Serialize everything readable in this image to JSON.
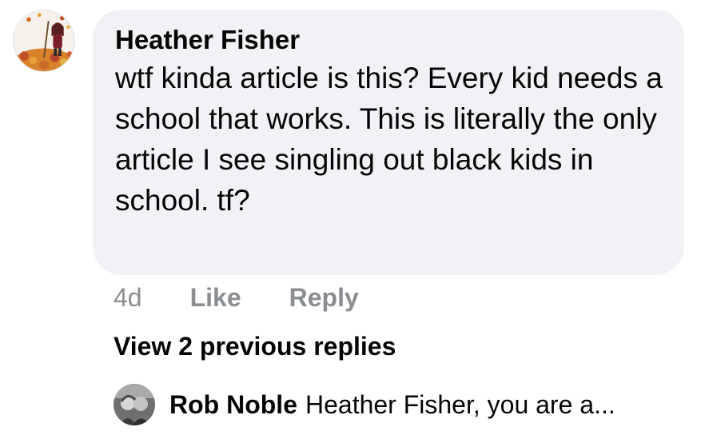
{
  "comment": {
    "author": "Heather Fisher",
    "text": "wtf kinda article is this? Every kid needs a school that works. This is literally the only article I see singling out black kids in school. tf?",
    "timestamp": "4d",
    "like_label": "Like",
    "reply_label": "Reply",
    "avatar_icon": "autumn-leaves-avatar"
  },
  "replies": {
    "view_previous_label": "View 2 previous replies",
    "preview": {
      "author": "Rob Noble",
      "text": "Heather Fisher, you are a...",
      "avatar_icon": "couple-photo-avatar"
    }
  },
  "colors": {
    "bubble": "#f0f2f5",
    "text_primary": "#050505",
    "text_secondary": "#8a8d91"
  }
}
